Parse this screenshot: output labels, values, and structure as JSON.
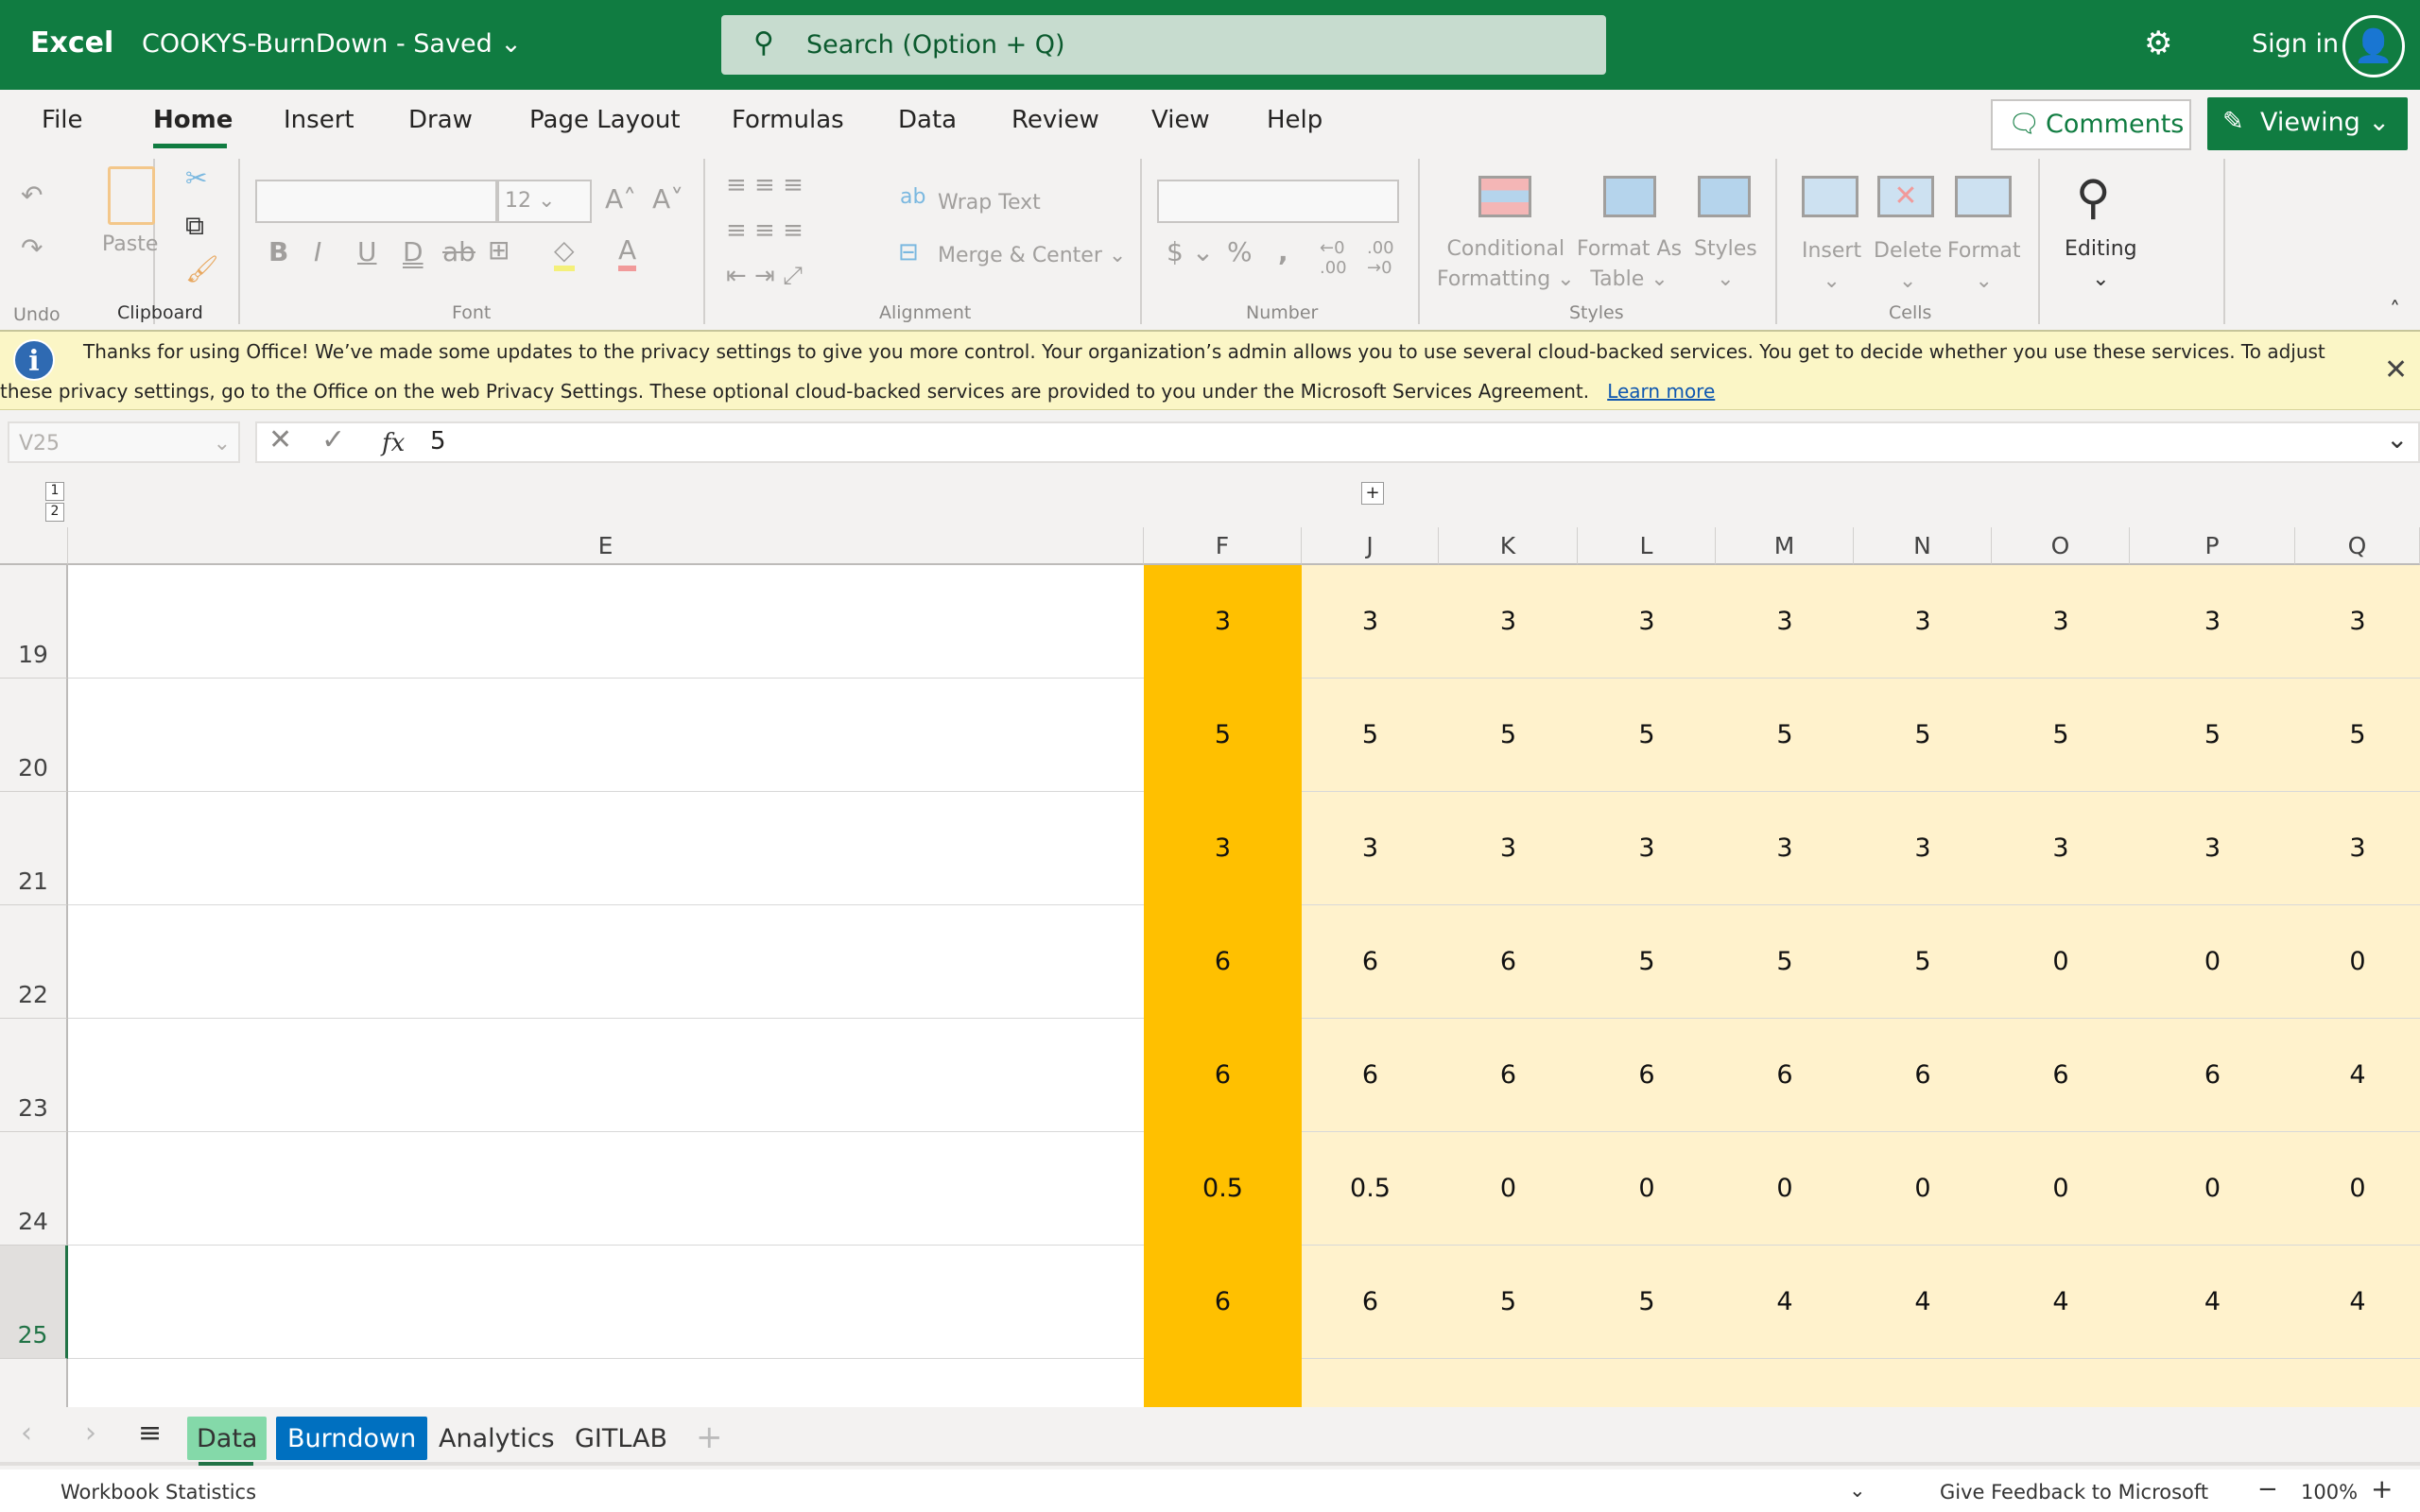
{
  "titlebar": {
    "app": "Excel",
    "document": "COOKYS-BurnDown  -  Saved ⌄",
    "search_placeholder": "Search (Option + Q)",
    "sign_in": "Sign in"
  },
  "menu": {
    "tabs": [
      "File",
      "Home",
      "Insert",
      "Draw",
      "Page Layout",
      "Formulas",
      "Data",
      "Review",
      "View",
      "Help"
    ],
    "active": "Home",
    "comments": "Comments",
    "viewing": "Viewing"
  },
  "ribbon": {
    "groups": [
      "Undo",
      "Clipboard",
      "Font",
      "Alignment",
      "Number",
      "Styles",
      "Cells"
    ],
    "paste": "Paste",
    "font_size": "12",
    "wrap_text": "Wrap Text",
    "merge_center": "Merge & Center",
    "conditional_formatting": [
      "Conditional",
      "Formatting"
    ],
    "format_as_table": [
      "Format As",
      "Table"
    ],
    "styles": "Styles",
    "insert": "Insert",
    "delete": "Delete",
    "format": "Format",
    "editing": "Editing"
  },
  "infobar": {
    "text": "Thanks for using Office! We’ve made some updates to the privacy settings to give you more control. Your organization’s admin allows you to use several cloud-backed services. You get to decide whether you use these services. To adjust these privacy settings, go to the Office on the web Privacy Settings. These optional cloud-backed services are provided to you under the Microsoft Services Agreement.",
    "link": "Learn more"
  },
  "formula_bar": {
    "name_box": "V25",
    "fx": "fx",
    "value": "5"
  },
  "outline": {
    "levels": [
      "1",
      "2"
    ],
    "expand": "+"
  },
  "sheet": {
    "columns": [
      "E",
      "F",
      "J",
      "K",
      "L",
      "M",
      "N",
      "O",
      "P",
      "Q"
    ],
    "rows": [
      {
        "n": "19",
        "values": [
          "",
          "3",
          "3",
          "3",
          "3",
          "3",
          "3",
          "3",
          "3",
          "3"
        ]
      },
      {
        "n": "20",
        "values": [
          "",
          "5",
          "5",
          "5",
          "5",
          "5",
          "5",
          "5",
          "5",
          "5"
        ]
      },
      {
        "n": "21",
        "values": [
          "",
          "3",
          "3",
          "3",
          "3",
          "3",
          "3",
          "3",
          "3",
          "3"
        ]
      },
      {
        "n": "22",
        "values": [
          "",
          "6",
          "6",
          "6",
          "5",
          "5",
          "5",
          "0",
          "0",
          "0"
        ]
      },
      {
        "n": "23",
        "values": [
          "",
          "6",
          "6",
          "6",
          "6",
          "6",
          "6",
          "6",
          "6",
          "4"
        ]
      },
      {
        "n": "24",
        "values": [
          "",
          "0.5",
          "0.5",
          "0",
          "0",
          "0",
          "0",
          "0",
          "0",
          "0"
        ]
      },
      {
        "n": "25",
        "values": [
          "",
          "6",
          "6",
          "5",
          "5",
          "4",
          "4",
          "4",
          "4",
          "4"
        ]
      }
    ],
    "selected_row": "25",
    "colors": {
      "column_F": "#ffc000",
      "data_fill": "#fff2cc"
    }
  },
  "sheet_tabs": [
    {
      "label": "Data",
      "color": "#84d9a9"
    },
    {
      "label": "Burndown",
      "color": "#0070c0"
    },
    {
      "label": "Analytics"
    },
    {
      "label": "GITLAB"
    }
  ],
  "status": {
    "left": "Workbook Statistics",
    "feedback": "Give Feedback to Microsoft",
    "zoom": "100%"
  }
}
